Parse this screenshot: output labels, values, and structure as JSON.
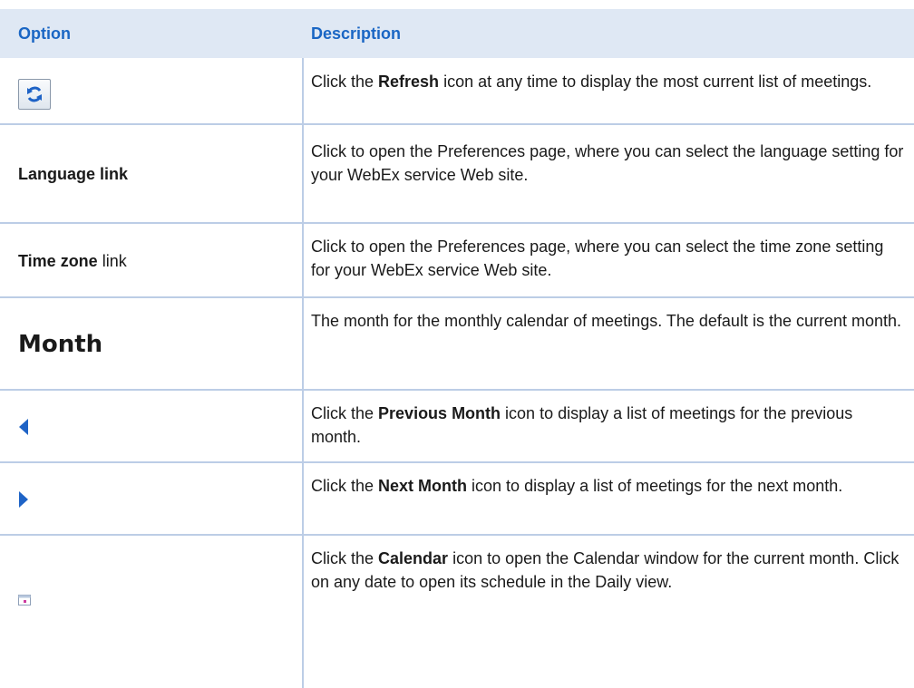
{
  "header": {
    "option_label": "Option",
    "description_label": "Description"
  },
  "rows": [
    {
      "option_icon": "refresh-icon",
      "desc": {
        "pre": "Click the ",
        "bold": "Refresh",
        "post": " icon at any time to display the most current list of meetings."
      }
    },
    {
      "option_text": "Language link",
      "desc": {
        "text": "Click to open the Preferences page, where you can select the language setting for your WebEx service Web site."
      }
    },
    {
      "option_bold": "Time zone",
      "option_rest": " link",
      "desc": {
        "text": "Click to open the Preferences page, where you can select the time zone setting for your WebEx service Web site."
      }
    },
    {
      "option_text": "Month",
      "desc": {
        "text": "The month for the monthly calendar of meetings. The default is the current month."
      }
    },
    {
      "option_icon": "previous-month-icon",
      "desc": {
        "pre": "Click the ",
        "bold": "Previous Month",
        "post": " icon to display a list of meetings for the previous month."
      }
    },
    {
      "option_icon": "next-month-icon",
      "desc": {
        "pre": "Click the ",
        "bold": "Next Month",
        "post": " icon to display a list of meetings for the next month."
      }
    },
    {
      "option_icon": "calendar-icon",
      "desc": {
        "pre": "Click the ",
        "bold": "Calendar",
        "post": " icon to open the Calendar window for the current month. Click on any date to open its schedule in the Daily view."
      }
    }
  ],
  "colors": {
    "header_bg": "#dfe8f4",
    "header_text": "#1a66c4",
    "grid_line": "#bccde6",
    "icon_blue": "#1e63c6"
  }
}
